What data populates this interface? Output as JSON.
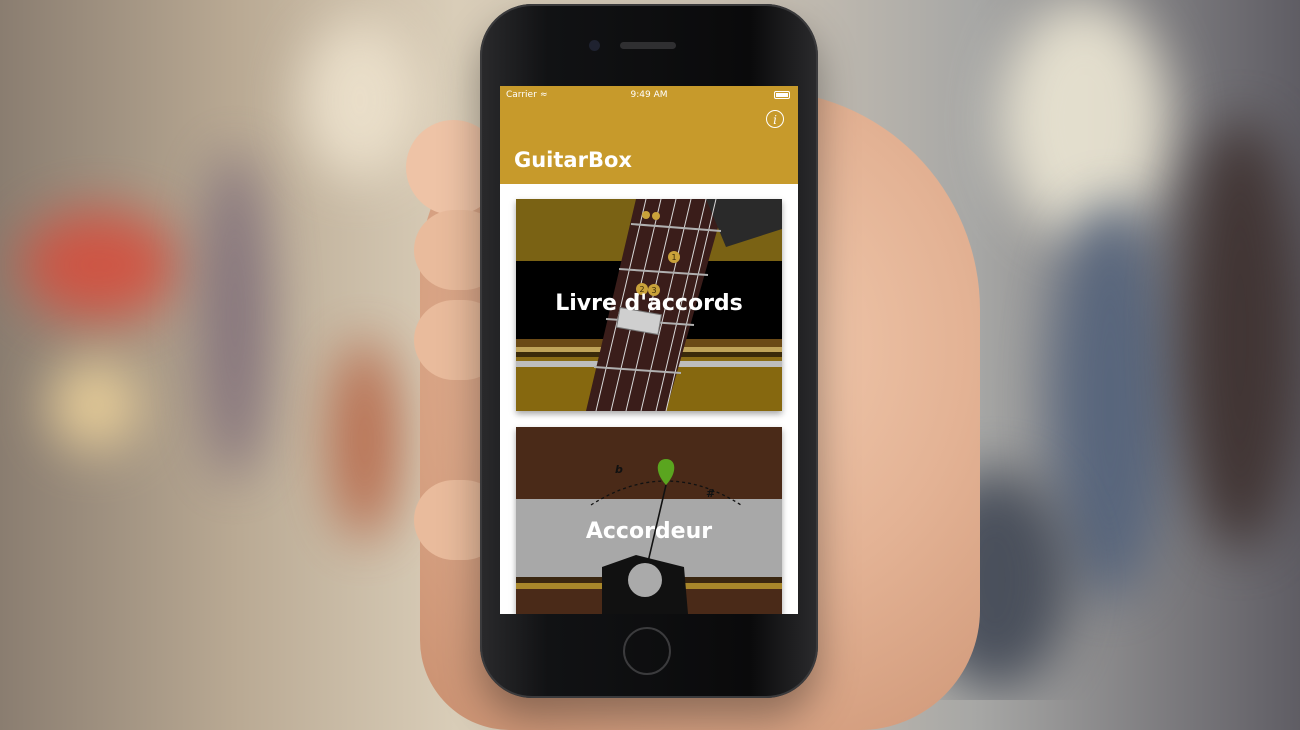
{
  "status_bar": {
    "carrier": "Carrier",
    "time": "9:49 AM"
  },
  "app": {
    "title": "GuitarBox",
    "info_icon": "info-icon"
  },
  "cards": [
    {
      "label": "Livre d'accords",
      "icon": "guitar-neck-illustration"
    },
    {
      "label": "Accordeur",
      "icon": "tuner-illustration"
    }
  ],
  "tuner": {
    "flat_symbol": "b",
    "sharp_symbol": "#"
  },
  "chord_diagram": {
    "dot_labels": [
      "1",
      "2",
      "3"
    ]
  },
  "colors": {
    "accent": "#c79a2b",
    "card1_bg": "#8a6c16",
    "card2_bg": "#4a2a18",
    "pick": "#5aa51f"
  }
}
